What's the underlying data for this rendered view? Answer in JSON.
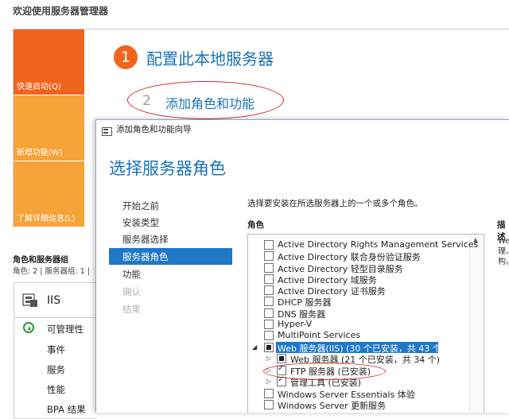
{
  "server_manager": {
    "title": "欢迎使用服务器管理器",
    "tiles": [
      {
        "label": "快速启动(Q)",
        "color": "#f0641e"
      },
      {
        "label": "新增功能(W)",
        "color": "#f6a33a"
      },
      {
        "label": "了解详细信息(L)",
        "color": "#f6a33a"
      }
    ],
    "step1": {
      "number": "1",
      "label": "配置此本地服务器"
    },
    "step2": {
      "number": "2",
      "label": "添加角色和功能"
    },
    "roles_group": {
      "title": "角色和服务器组",
      "subtitle": "角色: 2 | 服务器组: 1 |"
    },
    "iis": {
      "title": "IIS",
      "rows": [
        "可管理性",
        "事件",
        "服务",
        "性能",
        "BPA 结果"
      ]
    }
  },
  "wizard": {
    "window_title": "添加角色和功能向导",
    "heading": "选择服务器角色",
    "nav": [
      "开始之前",
      "安装类型",
      "服务器选择",
      "服务器角色",
      "功能",
      "确认",
      "结果"
    ],
    "active_nav": "服务器角色",
    "instruction": "选择要安装在所选服务器上的一个或多个角色。",
    "roles_label": "角色",
    "description_label": "描述",
    "description_text": [
      "We",
      "理、",
      "构。"
    ],
    "roles": [
      {
        "label": "Active Directory Rights Management Services",
        "state": "off"
      },
      {
        "label": "Active Directory 联合身份验证服务",
        "state": "off"
      },
      {
        "label": "Active Directory 轻型目录服务",
        "state": "off"
      },
      {
        "label": "Active Directory 域服务",
        "state": "off"
      },
      {
        "label": "Active Directory 证书服务",
        "state": "off"
      },
      {
        "label": "DHCP 服务器",
        "state": "off"
      },
      {
        "label": "DNS 服务器",
        "state": "off"
      },
      {
        "label": "Hyper-V",
        "state": "off"
      },
      {
        "label": "MultiPoint Services",
        "state": "off"
      },
      {
        "label": "Web 服务器(IIS) (30 个已安装，共 43 个)",
        "state": "partial",
        "selected": true,
        "expander": "◢"
      },
      {
        "label": "Web 服务器 (21 个已安装，共 34 个)",
        "state": "partial",
        "expander": "▷"
      },
      {
        "label": "FTP 服务器 (已安装)",
        "state": "on",
        "expander": "▷"
      },
      {
        "label": "管理工具 (已安装)",
        "state": "on",
        "expander": "▷"
      },
      {
        "label": "Windows Server Essentials 体验",
        "state": "off"
      },
      {
        "label": "Windows Server 更新服务",
        "state": "off"
      }
    ]
  },
  "colors": {
    "accent": "#1a74b8",
    "selection": "#1e78c8",
    "highlight_ellipse": "#d6232a"
  }
}
